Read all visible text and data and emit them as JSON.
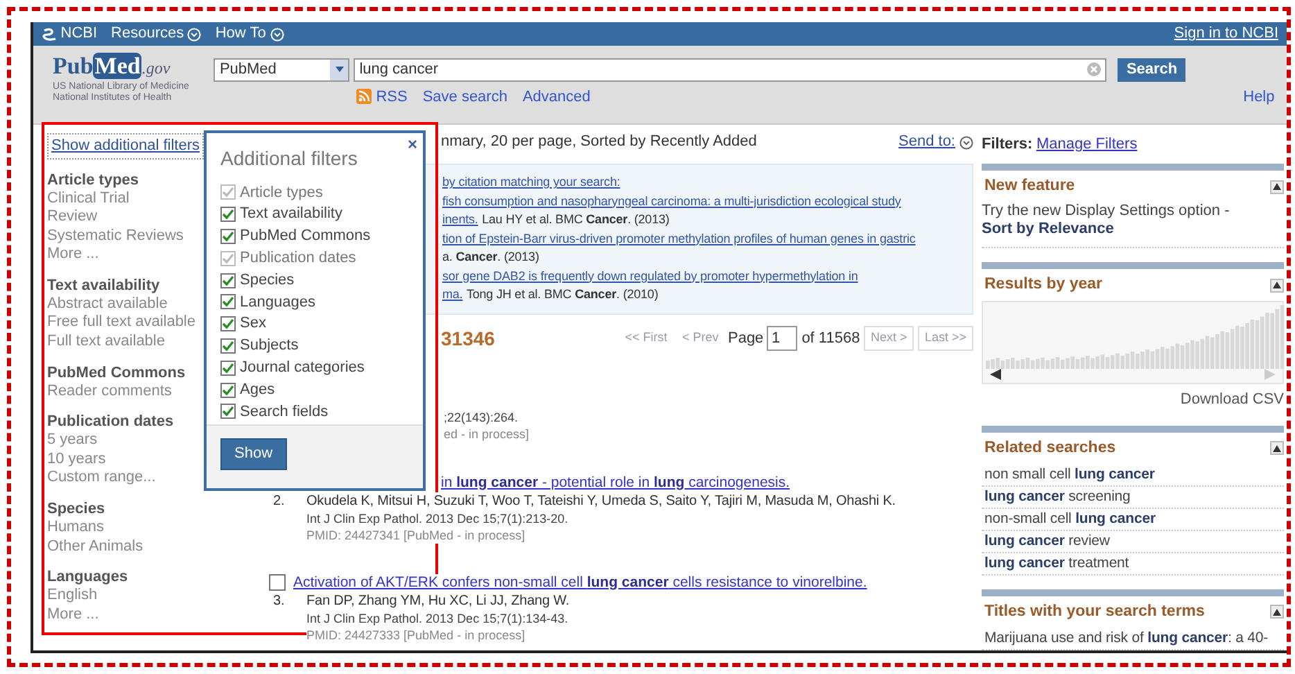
{
  "top_bar": {
    "logo": "NCBI",
    "menus": [
      {
        "label": "Resources"
      },
      {
        "label": "How To"
      }
    ],
    "sign_in": "Sign in to NCBI"
  },
  "header": {
    "logo": {
      "part1": "Pub",
      "part2": "Med",
      "part3": ".gov"
    },
    "agency_lines": [
      "US National Library of Medicine",
      "National Institutes of Health"
    ],
    "database": "PubMed",
    "query": "lung cancer",
    "search_button": "Search",
    "links": [
      {
        "label": "RSS",
        "kind": "feed"
      },
      {
        "label": "Save search",
        "kind": "plain"
      },
      {
        "label": "Advanced",
        "kind": "plain"
      }
    ],
    "help": "Help"
  },
  "sidebar": {
    "show_filters": "Show additional filters",
    "groups": [
      {
        "title": "Article types",
        "items": [
          "Clinical Trial",
          "Review",
          "Systematic Reviews",
          "More ..."
        ]
      },
      {
        "title": "Text availability",
        "items": [
          "Abstract available",
          "Free full text available",
          "Full text available"
        ]
      },
      {
        "title": "PubMed Commons",
        "items": [
          "Reader comments"
        ]
      },
      {
        "title": "Publication dates",
        "items": [
          "5 years",
          "10 years",
          "Custom range..."
        ]
      },
      {
        "title": "Species",
        "items": [
          "Humans",
          "Other Animals"
        ]
      },
      {
        "title": "Languages",
        "items": [
          "English",
          "More ..."
        ]
      }
    ]
  },
  "filters_popup": {
    "title": "Additional filters",
    "close": "×",
    "button": "Show",
    "options": [
      {
        "label": "Article types",
        "checked": true,
        "disabled": true
      },
      {
        "label": "Text availability",
        "checked": true,
        "disabled": false
      },
      {
        "label": "PubMed Commons",
        "checked": true,
        "disabled": false
      },
      {
        "label": "Publication dates",
        "checked": true,
        "disabled": true
      },
      {
        "label": "Species",
        "checked": true,
        "disabled": false
      },
      {
        "label": "Languages",
        "checked": true,
        "disabled": false
      },
      {
        "label": "Sex",
        "checked": true,
        "disabled": false
      },
      {
        "label": "Subjects",
        "checked": true,
        "disabled": false
      },
      {
        "label": "Journal categories",
        "checked": true,
        "disabled": false
      },
      {
        "label": "Ages",
        "checked": true,
        "disabled": false
      },
      {
        "label": "Search fields",
        "checked": true,
        "disabled": false
      }
    ]
  },
  "results": {
    "display_settings": "nmary, 20 per page, Sorted by Recently Added",
    "send_to": "Send to:",
    "citation_box": [
      {
        "link": "by citation matching your search:"
      },
      {
        "link": "fish consumption and nasopharyngeal carcinoma: a multi-jurisdiction ecological study"
      },
      {
        "link": "inents.",
        "text": "Lau HY et al. BMC **Cancer**. (2013)"
      },
      {
        "link": "tion of Epstein-Barr virus-driven promoter methylation profiles of human genes in gastric"
      },
      {
        "text": "a. **Cancer**. (2013)"
      },
      {
        "link": "sor gene DAB2 is frequently down regulated by promoter hypermethylation in"
      },
      {
        "link": "ma.",
        "text": "Tong JH et al. BMC **Cancer**. (2010)"
      }
    ],
    "count": "31346",
    "pager": {
      "first": "<< First",
      "prev": "< Prev",
      "page_label": "Page",
      "page": "1",
      "of": "of 11568",
      "next": "Next >",
      "last": "Last >>"
    },
    "items": [
      {
        "kind": "fragment",
        "journal": ";22(143):264.",
        "pmid": "ed - in process]"
      },
      {
        "kind": "covered",
        "number": "2.",
        "title": "in **lung cancer** - potential role in **lung** carcinogenesis.",
        "authors": "Okudela K, Mitsui H, Suzuki T, Woo T, Tateishi Y, Umeda S, Saito Y, Tajiri M, Masuda M, Ohashi K.",
        "journal": "Int J Clin Exp Pathol. 2013 Dec 15;7(1):213-20.",
        "pmid": "PMID: 24427341 [PubMed - in process]"
      },
      {
        "kind": "full",
        "checked": false,
        "number": "3.",
        "title": "Activation of AKT/ERK confers non-small cell **lung cancer** cells resistance to vinorelbine.",
        "authors": "Fan DP, Zhang YM, Hu XC, Li JJ, Zhang W.",
        "journal": "Int J Clin Exp Pathol. 2013 Dec 15;7(1):134-43.",
        "pmid": "PMID: 24427333 [PubMed - in process]"
      }
    ]
  },
  "right": {
    "filters_label": "Filters:",
    "manage": "Manage Filters",
    "portlets": [
      {
        "kind": "text",
        "title": "New feature",
        "text": "Try the new Display Settings option -",
        "bold": "Sort by Relevance"
      },
      {
        "kind": "chart",
        "title": "Results by year",
        "link": "Download CSV"
      },
      {
        "kind": "links",
        "title": "Related searches",
        "items": [
          "non small cell **lung cancer**",
          "**lung cancer** screening",
          "non-small cell **lung cancer**",
          "**lung cancer** review",
          "**lung cancer** treatment"
        ]
      },
      {
        "kind": "links",
        "title": "Titles with your search terms",
        "items": [
          "Marijuana use and risk of **lung cancer**: a 40-"
        ]
      }
    ]
  }
}
